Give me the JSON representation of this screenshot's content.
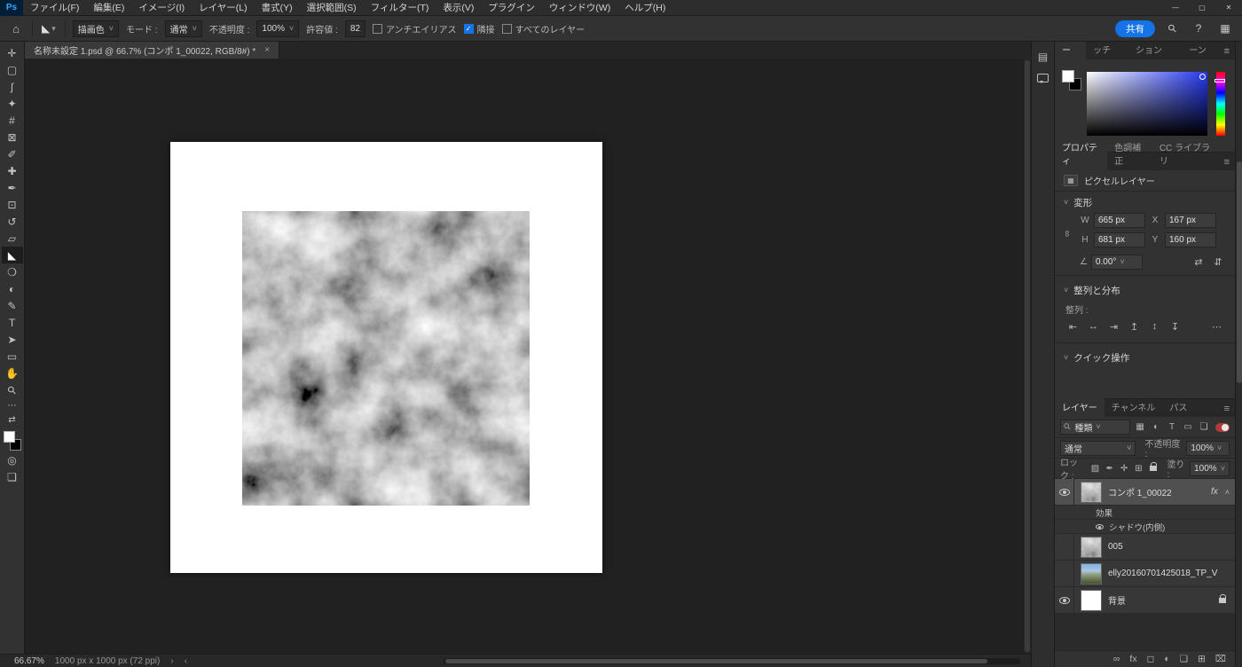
{
  "ui": {
    "caret": "˅",
    "chevron_up": "˄",
    "chevron_down": "˅",
    "check": "✓",
    "menu": "≡",
    "caret_small": "▾"
  },
  "menubar": {
    "logo": "Ps",
    "items": [
      "ファイル(F)",
      "編集(E)",
      "イメージ(I)",
      "レイヤー(L)",
      "書式(Y)",
      "選択範囲(S)",
      "フィルター(T)",
      "表示(V)",
      "プラグイン",
      "ウィンドウ(W)",
      "ヘルプ(H)"
    ]
  },
  "window_controls": {
    "minimize": "—",
    "maximize": "▢",
    "close": "✕"
  },
  "options": {
    "home_icon": "⌂",
    "tool_icon": "◣",
    "fill_source": "描画色",
    "mode_label": "モード :",
    "mode_value": "通常",
    "opacity_label": "不透明度 :",
    "opacity_value": "100%",
    "tolerance_label": "許容値 :",
    "tolerance_value": "82",
    "antialias": "アンチエイリアス",
    "contiguous": "隣接",
    "all_layers": "すべてのレイヤー",
    "share": "共有",
    "search_icon": "⚲",
    "help_icon": "?",
    "workspace_icon": "▦"
  },
  "tab": {
    "title": "名称未設定 1.psd @ 66.7% (コンポ 1_00022, RGB/8#) *",
    "close": "×"
  },
  "tools": [
    {
      "name": "move",
      "glyph": "✛"
    },
    {
      "name": "marquee",
      "glyph": "▢"
    },
    {
      "name": "lasso",
      "glyph": "ʃ"
    },
    {
      "name": "quick-selection",
      "glyph": "✦"
    },
    {
      "name": "crop",
      "glyph": "#"
    },
    {
      "name": "frame",
      "glyph": "⊠"
    },
    {
      "name": "eyedropper",
      "glyph": "✐"
    },
    {
      "name": "healing-brush",
      "glyph": "✚"
    },
    {
      "name": "brush",
      "glyph": "✒"
    },
    {
      "name": "clone-stamp",
      "glyph": "⊡"
    },
    {
      "name": "history-brush",
      "glyph": "↺"
    },
    {
      "name": "eraser",
      "glyph": "▱"
    },
    {
      "name": "paint-bucket",
      "glyph": "◣"
    },
    {
      "name": "blur",
      "glyph": "❍"
    },
    {
      "name": "dodge",
      "glyph": "◐"
    },
    {
      "name": "pen",
      "glyph": "✎"
    },
    {
      "name": "type",
      "glyph": "T"
    },
    {
      "name": "path-selection",
      "glyph": "➤"
    },
    {
      "name": "shape",
      "glyph": "▭"
    },
    {
      "name": "hand",
      "glyph": "✋"
    },
    {
      "name": "zoom",
      "glyph": "⚲"
    },
    {
      "name": "more",
      "glyph": "⋯"
    }
  ],
  "toolbar_extras": {
    "mini_swap": "⇄",
    "quick_mask": "◎",
    "screen_mode": "❏"
  },
  "strip": {
    "panel_icon": "▤"
  },
  "color_panel": {
    "tabs": [
      "カラー",
      "スウォッチ",
      "グラデーション",
      "パターン"
    ]
  },
  "properties": {
    "tabs": [
      "プロパティ",
      "色調補正",
      "CC ライブラリ"
    ],
    "layer_type": "ピクセルレイヤー",
    "layer_type_icon": "▦",
    "transform": {
      "title": "変形",
      "link_icon": "∞",
      "w_label": "W",
      "w_value": "665 px",
      "x_label": "X",
      "x_value": "167 px",
      "h_label": "H",
      "h_value": "681 px",
      "y_label": "Y",
      "y_value": "160 px",
      "angle_icon": "∠",
      "angle_value": "0.00°",
      "flip_h": "⇄",
      "flip_v": "⇵"
    },
    "align": {
      "title": "整列と分布",
      "label": "整列 :",
      "icons": [
        "⇤",
        "↔",
        "⇥",
        "↥",
        "↕",
        "↧"
      ],
      "more": "⋯"
    },
    "quick": {
      "title": "クイック操作"
    }
  },
  "layers_panel": {
    "tabs": [
      "レイヤー",
      "チャンネル",
      "パス"
    ],
    "search_icon": "⚲",
    "kind_value": "種類",
    "filter_icons": [
      "▦",
      "◐",
      "T",
      "▭",
      "❏"
    ],
    "blend_mode": "通常",
    "opacity_label": "不透明度 :",
    "opacity_value": "100%",
    "lock_label": "ロック :",
    "lock_icons": [
      "▨",
      "✒",
      "✛",
      "⊞"
    ],
    "fill_label": "塗り :",
    "fill_value": "100%",
    "fx_label": "fx",
    "rows": {
      "compo": {
        "name": "コンポ 1_00022"
      },
      "effects": {
        "name": "効果"
      },
      "shadow": {
        "name": "シャドウ(内側)"
      },
      "l005": {
        "name": "005"
      },
      "elly": {
        "name": "elly20160701425018_TP_V"
      },
      "bg": {
        "name": "背景"
      }
    },
    "bottom_icons": [
      "∞",
      "fx",
      "◻",
      "◐",
      "❏",
      "⊞",
      "⌧"
    ]
  },
  "statusbar": {
    "zoom": "66.67%",
    "doc_info": "1000 px x 1000 px (72 ppi)",
    "nav_right": "›",
    "nav_left": "‹"
  }
}
